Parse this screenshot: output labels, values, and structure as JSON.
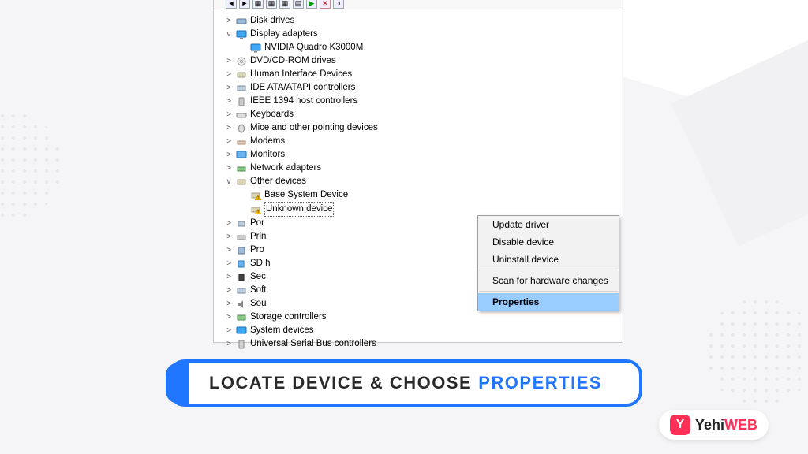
{
  "tree": {
    "disk_drives": "Disk drives",
    "display_adapters": "Display adapters",
    "nvidia": "NVIDIA Quadro K3000M",
    "dvd": "DVD/CD-ROM drives",
    "hid": "Human Interface Devices",
    "ide": "IDE ATA/ATAPI controllers",
    "ieee": "IEEE 1394 host controllers",
    "keyboards": "Keyboards",
    "mice": "Mice and other pointing devices",
    "modems": "Modems",
    "monitors": "Monitors",
    "network": "Network adapters",
    "other": "Other devices",
    "base_system": "Base System Device",
    "unknown": "Unknown device",
    "ports": "Por",
    "print": "Prin",
    "processors": "Pro",
    "sd": "SD h",
    "security": "Sec",
    "software": "Soft",
    "sound": "Sou",
    "storage": "Storage controllers",
    "system": "System devices",
    "usb": "Universal Serial Bus controllers"
  },
  "menu": {
    "update": "Update driver",
    "disable": "Disable device",
    "uninstall": "Uninstall device",
    "scan": "Scan for hardware changes",
    "properties": "Properties"
  },
  "caption": {
    "main": "LOCATE DEVICE & CHOOSE",
    "highlight": "PROPERTIES"
  },
  "logo": {
    "brand": "Yehi",
    "suffix": "WEB"
  }
}
